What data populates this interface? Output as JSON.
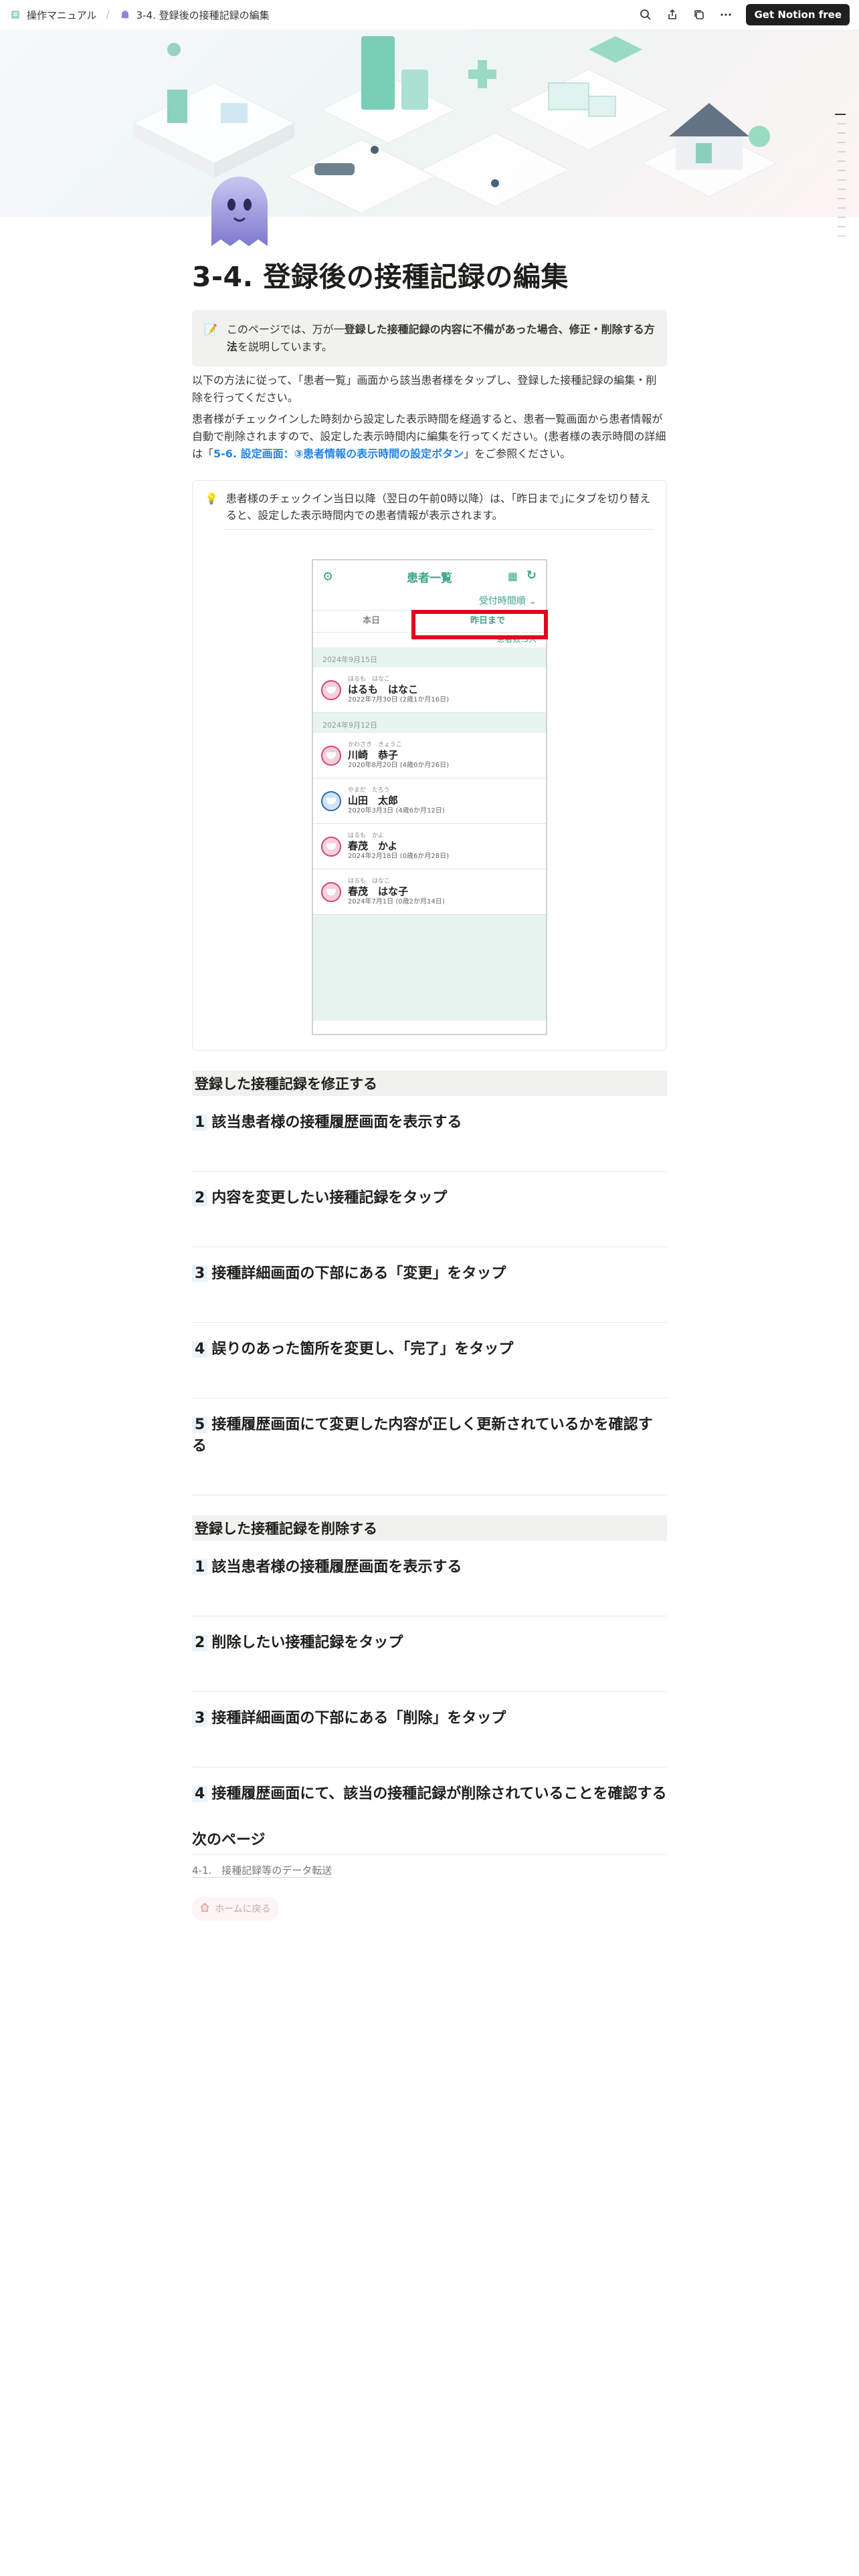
{
  "topbar": {
    "breadcrumb": [
      {
        "label": "操作マニュアル",
        "icon": "book-icon"
      },
      {
        "label": "3-4. 登録後の接種記録の編集",
        "icon": "ghost-icon"
      }
    ],
    "cta_label": "Get Notion free"
  },
  "page": {
    "title": "3-4. 登録後の接種記録の編集",
    "callout_pre": "このページでは、万が一",
    "callout_bold": "登録した接種記録の内容に不備があった場合、修正・削除する方法",
    "callout_post": "を説明しています。",
    "para1": "以下の方法に従って、「患者一覧」画面から該当患者様をタップし、登録した接種記録の編集・削除を行ってください。",
    "para2_pre": "患者様がチェックインした時刻から設定した表示時間を経過すると、患者一覧画面から患者情報が自動で削除されますので、設定した表示時間内に編集を行ってください。(患者様の表示時間の詳細は「",
    "para2_link": "5-6. 設定画面：③患者情報の表示時間の設定ボタン",
    "para2_post": "」をご参照ください。",
    "callout2": "患者様のチェックイン当日以降（翌日の午前0時以降）は、｢昨日まで｣にタブを切り替えると、設定した表示時間内での患者情報が表示されます。"
  },
  "phone": {
    "title": "患者一覧",
    "sort_label": "受付時間順 ⌄",
    "tabs": [
      "本日",
      "昨日まで"
    ],
    "count": "患者数:5人",
    "groups": [
      {
        "date": "2024年9月15日",
        "patients": [
          {
            "kana": "はるも　はなこ",
            "name": "はるも　はなこ",
            "dob": "2022年7月30日 (2歳1か月16日)",
            "gender": "f"
          }
        ]
      },
      {
        "date": "2024年9月12日",
        "patients": [
          {
            "kana": "かわさき　きょうこ",
            "name": "川崎　恭子",
            "dob": "2020年8月20日 (4歳0か月26日)",
            "gender": "f"
          },
          {
            "kana": "やまだ　たろう",
            "name": "山田　太郎",
            "dob": "2020年3月3日 (4歳6か月12日)",
            "gender": "m"
          },
          {
            "kana": "はるも　かよ",
            "name": "春茂　かよ",
            "dob": "2024年2月18日 (0歳6か月28日)",
            "gender": "f"
          },
          {
            "kana": "はるも　はなこ",
            "name": "春茂　はな子",
            "dob": "2024年7月1日 (0歳2か月14日)",
            "gender": "f"
          }
        ]
      }
    ]
  },
  "sections": [
    {
      "heading": "登録した接種記録を修正する",
      "steps": [
        {
          "num": "1",
          "text": "該当患者様の接種履歴画面を表示する"
        },
        {
          "num": "2",
          "text": "内容を変更したい接種記録をタップ"
        },
        {
          "num": "3",
          "text": "接種詳細画面の下部にある「変更」をタップ"
        },
        {
          "num": "4",
          "text": "誤りのあった箇所を変更し、「完了」をタップ"
        },
        {
          "num": "5",
          "text": "接種履歴画面にて変更した内容が正しく更新されているかを確認する"
        }
      ]
    },
    {
      "heading": "登録した接種記録を削除する",
      "steps": [
        {
          "num": "1",
          "text": "該当患者様の接種履歴画面を表示する"
        },
        {
          "num": "2",
          "text": "削除したい接種記録をタップ"
        },
        {
          "num": "3",
          "text": "接種詳細画面の下部にある「削除」をタップ"
        },
        {
          "num": "4",
          "text": "接種履歴画面にて、該当の接種記録が削除されていることを確認する"
        }
      ]
    }
  ],
  "next": {
    "heading": "次のページ",
    "link": "4-1.　接種記録等のデータ転送",
    "home": "ホームに戻る"
  },
  "colors": {
    "accent": "#3aa58a",
    "highlight": "#e4001c",
    "link": "#2383e2"
  }
}
